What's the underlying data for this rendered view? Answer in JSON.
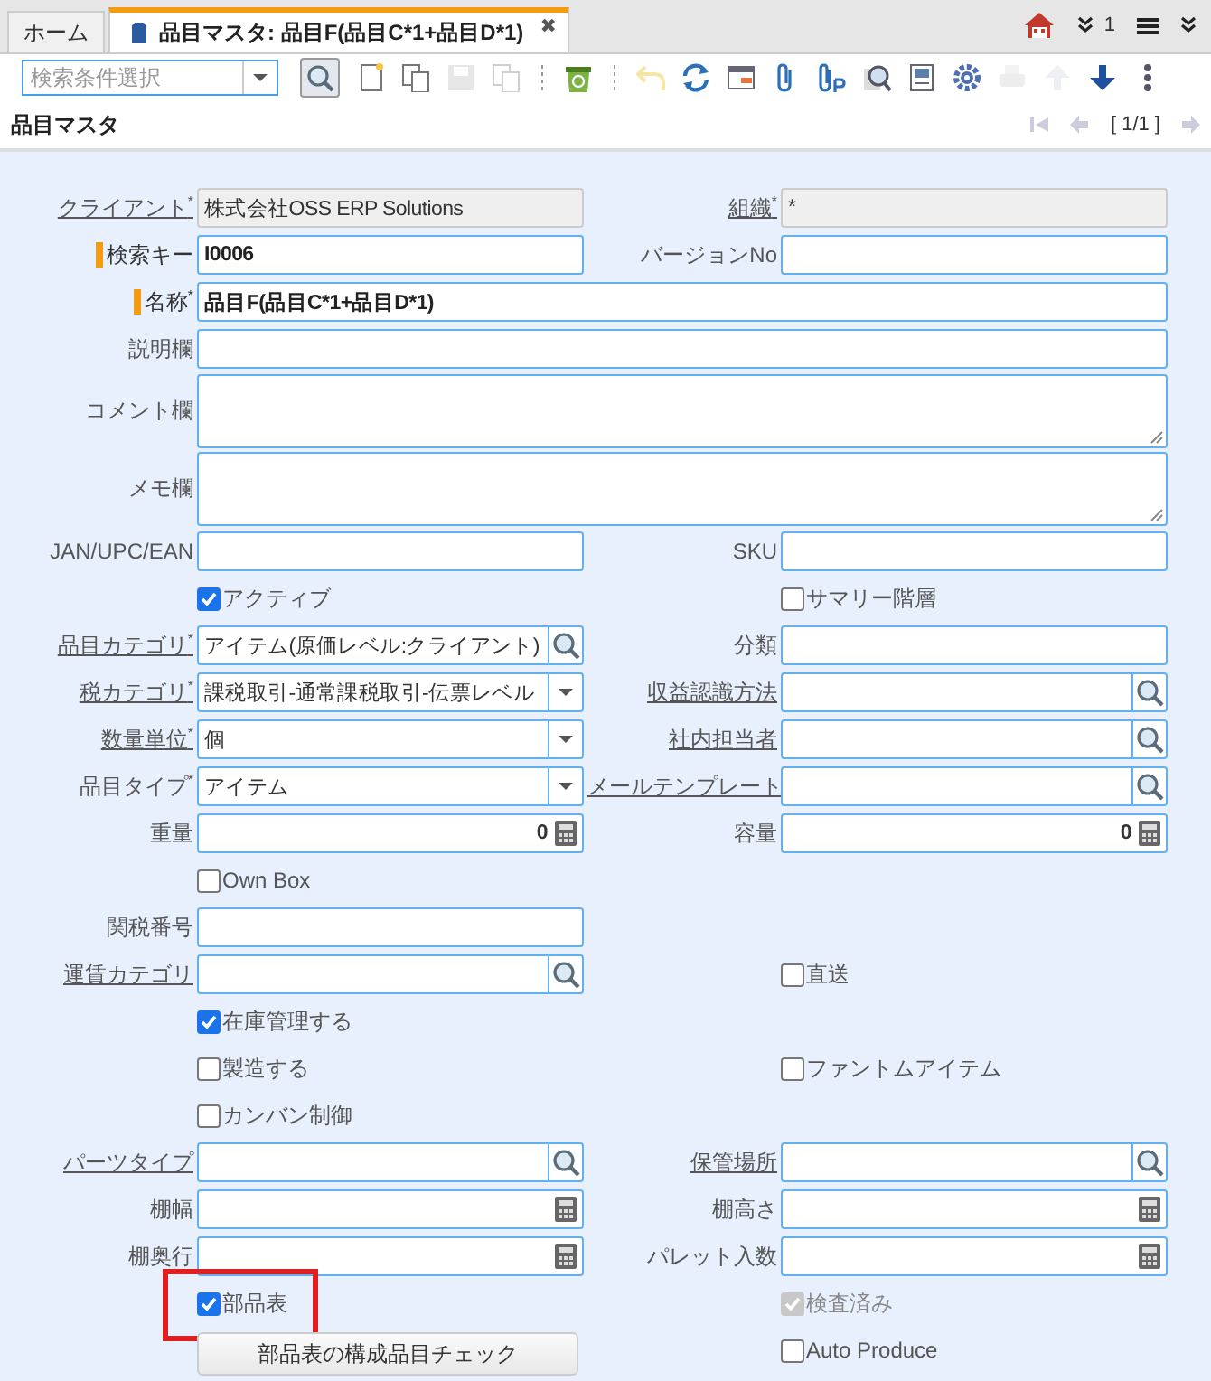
{
  "tabs": [
    {
      "label": "ホーム",
      "selected": false,
      "kind": "home"
    },
    {
      "label": "品目マスタ: 品目F(品目C*1+品目D*1)",
      "selected": true,
      "kind": "window",
      "close": "✖"
    }
  ],
  "tab_tools": {
    "count": "1"
  },
  "search": {
    "placeholder": "検索条件選択"
  },
  "toolbar": [
    {
      "kind": "find",
      "disabled": false
    },
    {
      "kind": "new",
      "disabled": false
    },
    {
      "kind": "copy",
      "disabled": false
    },
    {
      "kind": "save",
      "disabled": true
    },
    {
      "kind": "copy",
      "disabled": true
    },
    {
      "kind": "sep",
      "disabled": false
    },
    {
      "kind": "bin",
      "disabled": false
    },
    {
      "kind": "sep",
      "disabled": false
    },
    {
      "kind": "undo",
      "disabled": true
    },
    {
      "kind": "refresh",
      "disabled": false
    },
    {
      "kind": "grid",
      "disabled": false
    },
    {
      "kind": "clip",
      "disabled": false
    },
    {
      "kind": "clip2",
      "disabled": false
    },
    {
      "kind": "zoom",
      "disabled": false
    },
    {
      "kind": "report",
      "disabled": false
    },
    {
      "kind": "gear",
      "disabled": false
    },
    {
      "kind": "print",
      "disabled": true
    },
    {
      "kind": "up",
      "disabled": true
    },
    {
      "kind": "down",
      "disabled": false
    },
    {
      "kind": "more",
      "disabled": false
    }
  ],
  "title": "品目マスタ",
  "record_nav": {
    "position": "[ 1/1 ]"
  },
  "form_rows": [
    {
      "left": {
        "label": "クライアント$^{*}$",
        "linked": true,
        "kind": "text",
        "readonly": true,
        "value": "株式会社OSS ERP Solutions"
      },
      "right": {
        "label": "組織$^{*}$",
        "linked": true,
        "kind": "text",
        "readonly": true,
        "value": "*"
      }
    },
    {
      "left": {
        "label": "検索キー",
        "key": true,
        "kind": "text",
        "value": "I0006",
        "bold": true
      },
      "right": {
        "label": "バージョンNo",
        "kind": "text"
      }
    },
    {
      "full": {
        "label": "名称$^{*}$",
        "key": true,
        "kind": "text",
        "value": "品目F(品目C*1+品目D*1)",
        "bold": true
      }
    },
    {
      "full": {
        "label": "説明欄",
        "kind": "text"
      }
    },
    {
      "full": {
        "label": "コメント欄",
        "kind": "textarea"
      }
    },
    {
      "full": {
        "label": "メモ欄",
        "kind": "textarea"
      }
    },
    {
      "left": {
        "label": "JAN/UPC/EAN",
        "kind": "text"
      },
      "right": {
        "label": "SKU",
        "kind": "text"
      }
    },
    {
      "left": {
        "label": "アクティブ",
        "kind": "checkbox",
        "checked": true
      },
      "right": {
        "label": "サマリー階層",
        "kind": "checkbox",
        "checked": false
      }
    },
    {
      "left": {
        "label": "品目カテゴリ$^{*}$",
        "linked": true,
        "kind": "lookup",
        "value": "アイテム(原価レベル:クライアント)"
      },
      "right": {
        "label": "分類",
        "kind": "text"
      }
    },
    {
      "left": {
        "label": "税カテゴリ$^{*}$",
        "linked": true,
        "kind": "dropdown",
        "value": "課税取引-通常課税取引-伝票レベル"
      },
      "right": {
        "label": "収益認識方法",
        "linked": true,
        "kind": "lookup"
      }
    },
    {
      "left": {
        "label": "数量単位$^{*}$",
        "linked": true,
        "kind": "dropdown",
        "value": "個"
      },
      "right": {
        "label": "社内担当者",
        "linked": true,
        "kind": "lookup"
      }
    },
    {
      "left": {
        "label": "品目タイプ$^{*}$",
        "kind": "dropdown",
        "value": "アイテム"
      },
      "right": {
        "label": "メールテンプレート",
        "linked": true,
        "kind": "lookup"
      }
    },
    {
      "left": {
        "label": "重量",
        "kind": "number",
        "value": "0"
      },
      "right": {
        "label": "容量",
        "kind": "number",
        "value": "0"
      }
    },
    {
      "left": {
        "label": "Own Box",
        "kind": "checkbox",
        "checked": false
      }
    },
    {
      "left": {
        "label": "関税番号",
        "kind": "text"
      }
    },
    {
      "left": {
        "label": "運賃カテゴリ",
        "linked": true,
        "kind": "lookup"
      },
      "right": {
        "label": "直送",
        "kind": "checkbox",
        "checked": false
      }
    },
    {
      "left": {
        "label": "在庫管理する",
        "kind": "checkbox",
        "checked": true
      }
    },
    {
      "left": {
        "label": "製造する",
        "kind": "checkbox",
        "checked": false
      },
      "right": {
        "label": "ファントムアイテム",
        "kind": "checkbox",
        "checked": false
      }
    },
    {
      "left": {
        "label": "カンバン制御",
        "kind": "checkbox",
        "checked": false
      }
    },
    {
      "left": {
        "label": "パーツタイプ",
        "linked": true,
        "kind": "lookup"
      },
      "right": {
        "label": "保管場所",
        "linked": true,
        "kind": "lookup"
      }
    },
    {
      "left": {
        "label": "棚幅",
        "kind": "number"
      },
      "right": {
        "label": "棚高さ",
        "kind": "number"
      }
    },
    {
      "left": {
        "label": "棚奥行",
        "kind": "number"
      },
      "right": {
        "label": "パレット入数",
        "kind": "number"
      }
    },
    {
      "left": {
        "label": "部品表",
        "kind": "checkbox",
        "checked": true,
        "highlighted": true
      },
      "right": {
        "label": "検査済み",
        "kind": "checkbox",
        "checked": true,
        "disabled": true
      }
    },
    {
      "left": {
        "label": "部品表の構成品目チェック",
        "kind": "button"
      },
      "right": {
        "label": "Auto Produce",
        "kind": "checkbox",
        "checked": false
      }
    }
  ]
}
